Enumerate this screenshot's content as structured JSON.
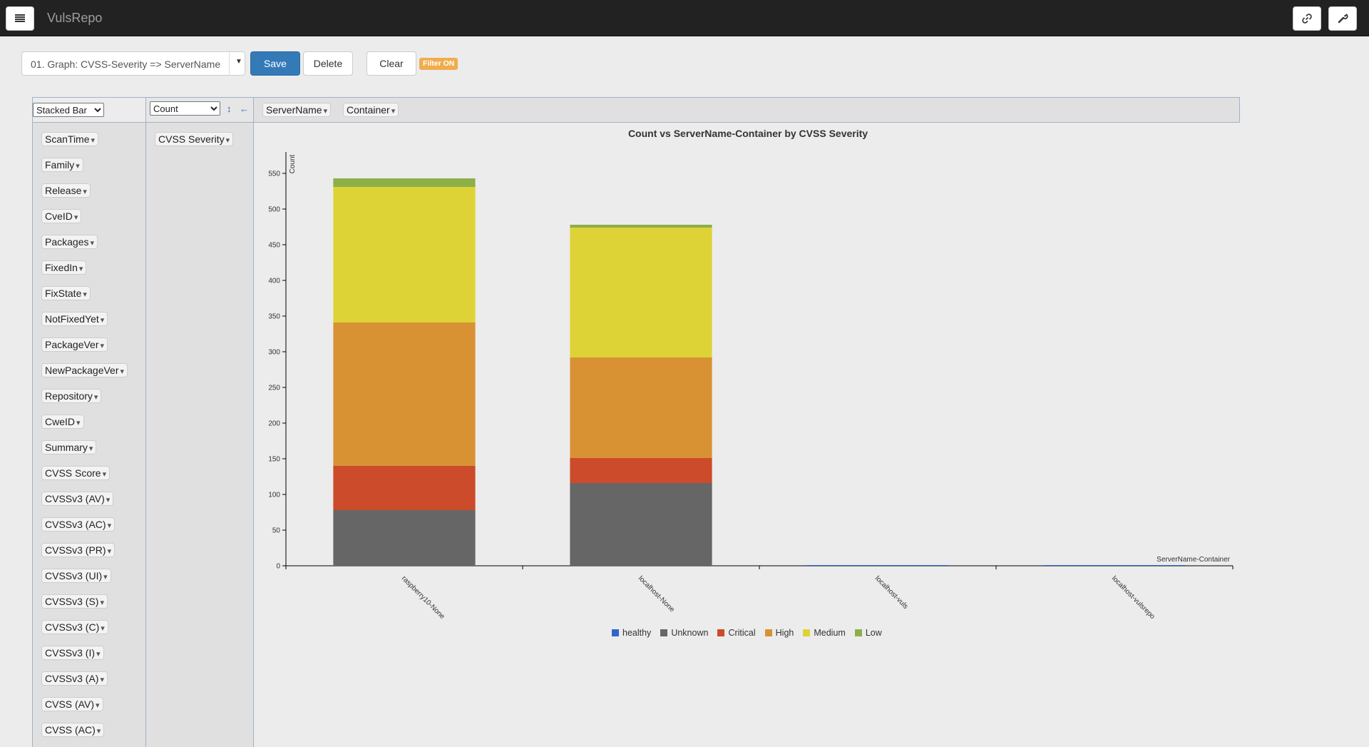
{
  "app": {
    "brand": "VulsRepo"
  },
  "icons": {
    "menu": "menu-icon",
    "link": "link-icon",
    "settings": "wrench-icon"
  },
  "toolbar": {
    "preset_value": "01. Graph: CVSS-Severity => ServerName",
    "save_label": "Save",
    "delete_label": "Delete",
    "clear_label": "Clear",
    "filter_badge": "Filter ON"
  },
  "pivot": {
    "renderer": "Stacked Bar",
    "aggregator": "Count",
    "col_attrs": [
      "ServerName",
      "Container"
    ],
    "row_attrs": [
      "CVSS Severity"
    ],
    "unused_attrs": [
      "ScanTime",
      "Family",
      "Release",
      "CveID",
      "Packages",
      "FixedIn",
      "FixState",
      "NotFixedYet",
      "PackageVer",
      "NewPackageVer",
      "Repository",
      "CweID",
      "Summary",
      "CVSS Score",
      "CVSSv3 (AV)",
      "CVSSv3 (AC)",
      "CVSSv3 (PR)",
      "CVSSv3 (UI)",
      "CVSSv3 (S)",
      "CVSSv3 (C)",
      "CVSSv3 (I)",
      "CVSSv3 (A)",
      "CVSS (AV)",
      "CVSS (AC)"
    ]
  },
  "chart_data": {
    "type": "bar",
    "stacked": true,
    "title": "Count vs ServerName-Container by CVSS Severity",
    "xlabel": "ServerName-Container",
    "ylabel": "Count",
    "ylim": [
      0,
      580
    ],
    "yticks": [
      0,
      50,
      100,
      150,
      200,
      250,
      300,
      350,
      400,
      450,
      500,
      550
    ],
    "categories": [
      "raspberry10-None",
      "localhost-None",
      "localhost-vuls",
      "localhost-vulsrepo"
    ],
    "series": [
      {
        "name": "healthy",
        "color": "#3366cc",
        "values": [
          0,
          0,
          1,
          1
        ]
      },
      {
        "name": "Unknown",
        "color": "#666666",
        "values": [
          78,
          116,
          0,
          0
        ]
      },
      {
        "name": "Critical",
        "color": "#cc4b2b",
        "values": [
          62,
          35,
          0,
          0
        ]
      },
      {
        "name": "High",
        "color": "#d89234",
        "values": [
          201,
          141,
          0,
          0
        ]
      },
      {
        "name": "Medium",
        "color": "#ded336",
        "values": [
          190,
          182,
          0,
          0
        ]
      },
      {
        "name": "Low",
        "color": "#8daf47",
        "values": [
          12,
          4,
          0,
          0
        ]
      }
    ],
    "grid": false,
    "legend_position": "bottom"
  }
}
